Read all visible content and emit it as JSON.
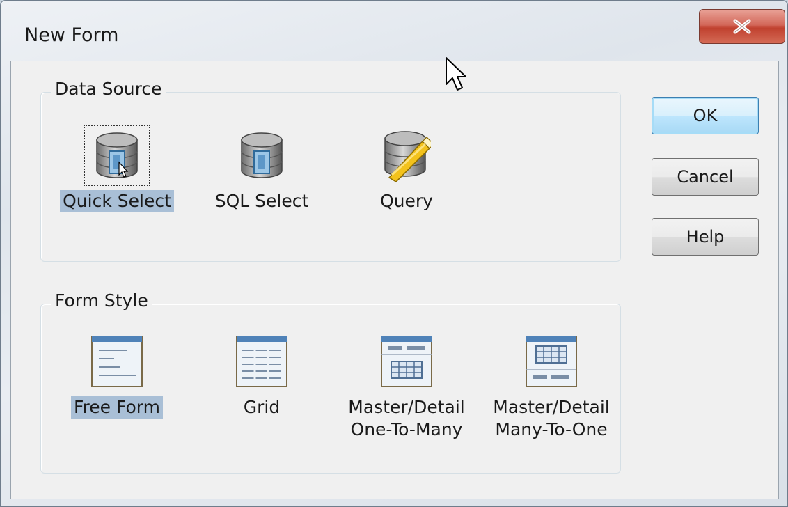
{
  "window": {
    "title": "New Form",
    "close_glyph": "X"
  },
  "data_source": {
    "legend": "Data Source",
    "items": [
      {
        "label": "Quick Select",
        "icon": "database-quick-select-icon",
        "selected": true
      },
      {
        "label": "SQL Select",
        "icon": "database-sql-icon",
        "selected": false
      },
      {
        "label": "Query",
        "icon": "database-query-pencil-icon",
        "selected": false
      }
    ]
  },
  "form_style": {
    "legend": "Form Style",
    "items": [
      {
        "label": "Free Form",
        "icon": "free-form-icon",
        "selected": true
      },
      {
        "label": "Grid",
        "icon": "grid-form-icon",
        "selected": false
      },
      {
        "label": "Master/Detail\nOne-To-Many",
        "icon": "master-detail-one-to-many-icon",
        "selected": false
      },
      {
        "label": "Master/Detail\nMany-To-One",
        "icon": "master-detail-many-to-one-icon",
        "selected": false
      }
    ]
  },
  "buttons": {
    "ok": "OK",
    "cancel": "Cancel",
    "help": "Help"
  },
  "colors": {
    "selection_highlight": "#a9bfd6",
    "close_button": "#c0412f",
    "default_button_border": "#3c7fb1"
  }
}
